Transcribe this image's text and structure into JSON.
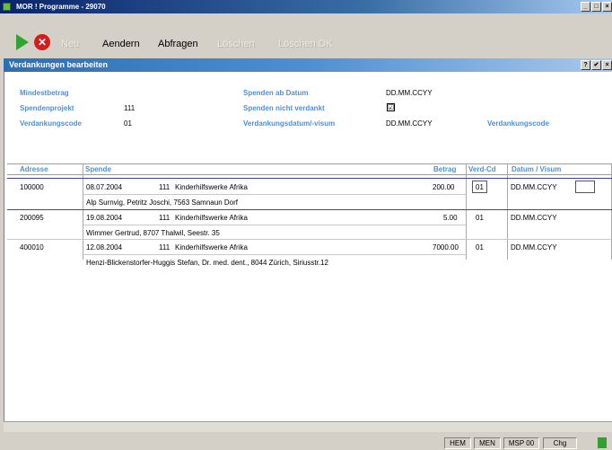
{
  "window": {
    "title": "MOR ! Programme - 29070",
    "buttons": [
      "_",
      "□",
      "×"
    ]
  },
  "toolbar": {
    "neu": "Neu",
    "aendern": "Aendern",
    "abfragen": "Abfragen",
    "loeschen": "Löschen",
    "loeschen_ok": "Löschen OK"
  },
  "panel": {
    "title": "Verdankungen bearbeiten",
    "buttons": [
      "?",
      "✔",
      "×"
    ]
  },
  "form": {
    "mindestbetrag_label": "Mindestbetrag",
    "spendenprojekt_label": "Spendenprojekt",
    "spendenprojekt_value": "111",
    "verdankungscode_label": "Verdankungscode",
    "verdankungscode_value": "01",
    "spenden_ab_datum_label": "Spenden ab Datum",
    "spenden_ab_datum_value": "DD.MM.CCYY",
    "spenden_nicht_verdankt_label": "Spenden nicht verdankt",
    "spenden_nicht_verdankt_checked": "☑",
    "verdankungsdatum_label": "Verdankungsdatum/-visum",
    "verdankungsdatum_value": "DD.MM.CCYY",
    "verdankungscode2_label": "Verdankungscode"
  },
  "grid": {
    "headers": {
      "adresse": "Adresse",
      "spende": "Spende",
      "betrag": "Betrag",
      "verdcd": "Verd-Cd",
      "datum": "Datum / Visum"
    },
    "rows": [
      {
        "adresse": "100000",
        "datum": "08.07.2004",
        "projekt": "111",
        "projekt_name": "Kinderhilfswerke Afrika",
        "name": "Alp Surnvig, Petritz Joschi, 7563 Samnaun Dorf",
        "betrag": "200.00",
        "verdcd": "01",
        "verd_datum": "DD.MM.CCYY"
      },
      {
        "adresse": "200095",
        "datum": "19.08.2004",
        "projekt": "111",
        "projekt_name": "Kinderhilfswerke Afrika",
        "name": "Wimmer Gertrud, 8707 Thalwil, Seestr. 35",
        "betrag": "5.00",
        "verdcd": "01",
        "verd_datum": "DD.MM.CCYY"
      },
      {
        "adresse": "400010",
        "datum": "12.08.2004",
        "projekt": "111",
        "projekt_name": "Kinderhilfswerke Afrika",
        "name": "Henzi-Blickenstorfer-Huggis Stefan, Dr. med. dent., 8044 Zürich, Siriusstr.12",
        "betrag": "7000.00",
        "verdcd": "01",
        "verd_datum": "DD.MM.CCYY"
      }
    ]
  },
  "status": {
    "hem": "HEM",
    "men": "MEN",
    "msp": "MSP 00",
    "chg": "Chg"
  },
  "colors": {
    "label_blue": "#4d8fd9",
    "header_blue": "#2b6fb5",
    "selection": "#3c3cd6"
  }
}
